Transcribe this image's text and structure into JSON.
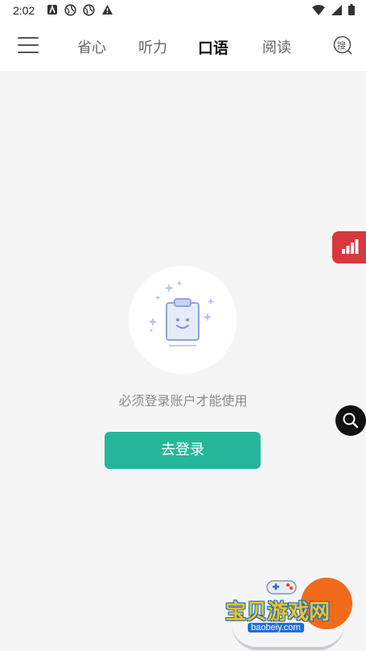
{
  "status_bar": {
    "time": "2:02",
    "left_icons": [
      "a-notification-icon",
      "globe-icon",
      "globe-icon",
      "warning-icon"
    ],
    "right_icons": [
      "wifi-icon",
      "cell-signal-icon",
      "battery-icon"
    ]
  },
  "header": {
    "menu_icon": "hamburger-icon",
    "tabs": [
      {
        "label": "省心",
        "active": false
      },
      {
        "label": "听力",
        "active": false
      },
      {
        "label": "口语",
        "active": true
      },
      {
        "label": "阅读",
        "active": false
      }
    ],
    "search_label": "搜"
  },
  "main": {
    "empty_illustration": "clipboard-icon",
    "message": "必须登录账户才能使用",
    "login_button": "去登录"
  },
  "floating": {
    "stats_icon": "bar-chart-icon",
    "search_icon": "magnifier-icon"
  },
  "watermark": {
    "text": "宝贝游戏网",
    "url": "baobeiy.com"
  },
  "colors": {
    "accent": "#26b79b",
    "float_red": "#d9363e",
    "background": "#f5f5f5"
  }
}
